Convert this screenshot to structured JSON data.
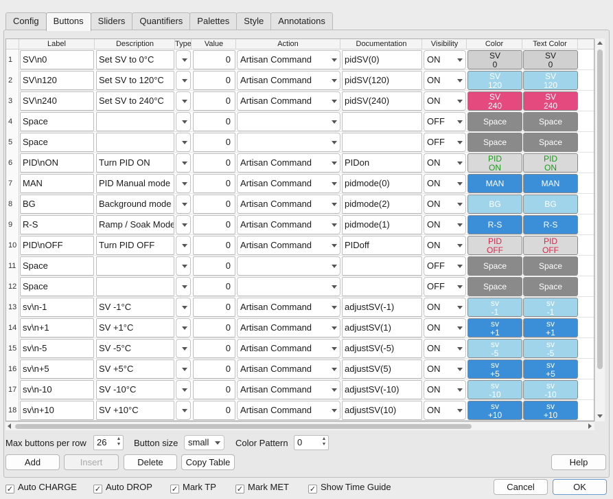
{
  "tabs": [
    "Config",
    "Buttons",
    "Sliders",
    "Quantifiers",
    "Palettes",
    "Style",
    "Annotations"
  ],
  "active_tab": "Buttons",
  "columns": [
    "Label",
    "Description",
    "Type",
    "Value",
    "Action",
    "Documentation",
    "Visibility",
    "Color",
    "Text Color"
  ],
  "rows": [
    {
      "n": "1",
      "label": "SV\\n0",
      "desc": "Set SV to 0°C",
      "value": "0",
      "action": "Artisan Command",
      "doc": "pidSV(0)",
      "vis": "ON",
      "swatch": "SV\n0",
      "bg": "#d0d0d0",
      "fg": "#1a1a1a"
    },
    {
      "n": "2",
      "label": "SV\\n120",
      "desc": "Set SV to 120°C",
      "value": "0",
      "action": "Artisan Command",
      "doc": "pidSV(120)",
      "vis": "ON",
      "swatch": "SV\n120",
      "bg": "#9fd4ea",
      "fg": "#ffffff"
    },
    {
      "n": "3",
      "label": "SV\\n240",
      "desc": "Set SV to 240°C",
      "value": "0",
      "action": "Artisan Command",
      "doc": "pidSV(240)",
      "vis": "ON",
      "swatch": "SV\n240",
      "bg": "#e44a7e",
      "fg": "#ffffff"
    },
    {
      "n": "4",
      "label": "Space",
      "desc": "",
      "value": "0",
      "action": "",
      "doc": "",
      "vis": "OFF",
      "swatch": "Space",
      "bg": "#8a8a8a",
      "fg": "#ffffff"
    },
    {
      "n": "5",
      "label": "Space",
      "desc": "",
      "value": "0",
      "action": "",
      "doc": "",
      "vis": "OFF",
      "swatch": "Space",
      "bg": "#8a8a8a",
      "fg": "#ffffff"
    },
    {
      "n": "6",
      "label": "PID\\nON",
      "desc": "Turn PID ON",
      "value": "0",
      "action": "Artisan Command",
      "doc": "PIDon",
      "vis": "ON",
      "swatch": "PID\nON",
      "bg": "#d9d9d9",
      "fg": "#1a9c1a"
    },
    {
      "n": "7",
      "label": "MAN",
      "desc": "PID Manual mode",
      "value": "0",
      "action": "Artisan Command",
      "doc": "pidmode(0)",
      "vis": "ON",
      "swatch": "MAN",
      "bg": "#3a8fd8",
      "fg": "#ffffff"
    },
    {
      "n": "8",
      "label": "BG",
      "desc": "Background mode",
      "value": "0",
      "action": "Artisan Command",
      "doc": "pidmode(2)",
      "vis": "ON",
      "swatch": "BG",
      "bg": "#9fd4ea",
      "fg": "#ffffff"
    },
    {
      "n": "9",
      "label": "R-S",
      "desc": "Ramp / Soak Mode",
      "value": "0",
      "action": "Artisan Command",
      "doc": "pidmode(1)",
      "vis": "ON",
      "swatch": "R-S",
      "bg": "#3a8fd8",
      "fg": "#ffffff"
    },
    {
      "n": "10",
      "label": "PID\\nOFF",
      "desc": "Turn PID OFF",
      "value": "0",
      "action": "Artisan Command",
      "doc": "PIDoff",
      "vis": "ON",
      "swatch": "PID\nOFF",
      "bg": "#d9d9d9",
      "fg": "#d9264d"
    },
    {
      "n": "11",
      "label": "Space",
      "desc": "",
      "value": "0",
      "action": "",
      "doc": "",
      "vis": "OFF",
      "swatch": "Space",
      "bg": "#8a8a8a",
      "fg": "#ffffff"
    },
    {
      "n": "12",
      "label": "Space",
      "desc": "",
      "value": "0",
      "action": "",
      "doc": "",
      "vis": "OFF",
      "swatch": "Space",
      "bg": "#8a8a8a",
      "fg": "#ffffff"
    },
    {
      "n": "13",
      "label": "sv\\n-1",
      "desc": "SV -1°C",
      "value": "0",
      "action": "Artisan Command",
      "doc": "adjustSV(-1)",
      "vis": "ON",
      "swatch": "sv\n-1",
      "bg": "#9fd4ea",
      "fg": "#ffffff"
    },
    {
      "n": "14",
      "label": "sv\\n+1",
      "desc": "SV +1°C",
      "value": "0",
      "action": "Artisan Command",
      "doc": "adjustSV(1)",
      "vis": "ON",
      "swatch": "sv\n+1",
      "bg": "#3a8fd8",
      "fg": "#ffffff"
    },
    {
      "n": "15",
      "label": "sv\\n-5",
      "desc": "SV -5°C",
      "value": "0",
      "action": "Artisan Command",
      "doc": "adjustSV(-5)",
      "vis": "ON",
      "swatch": "sv\n-5",
      "bg": "#9fd4ea",
      "fg": "#ffffff"
    },
    {
      "n": "16",
      "label": "sv\\n+5",
      "desc": "SV +5°C",
      "value": "0",
      "action": "Artisan Command",
      "doc": "adjustSV(5)",
      "vis": "ON",
      "swatch": "sv\n+5",
      "bg": "#3a8fd8",
      "fg": "#ffffff"
    },
    {
      "n": "17",
      "label": "sv\\n-10",
      "desc": "SV -10°C",
      "value": "0",
      "action": "Artisan Command",
      "doc": "adjustSV(-10)",
      "vis": "ON",
      "swatch": "sv\n-10",
      "bg": "#9fd4ea",
      "fg": "#ffffff"
    },
    {
      "n": "18",
      "label": "sv\\n+10",
      "desc": "SV +10°C",
      "value": "0",
      "action": "Artisan Command",
      "doc": "adjustSV(10)",
      "vis": "ON",
      "swatch": "sv\n+10",
      "bg": "#3a8fd8",
      "fg": "#ffffff"
    }
  ],
  "controls": {
    "max_buttons_label": "Max buttons per row",
    "max_buttons_value": "26",
    "button_size_label": "Button size",
    "button_size_value": "small",
    "color_pattern_label": "Color Pattern",
    "color_pattern_value": "0"
  },
  "buttons": {
    "add": "Add",
    "insert": "Insert",
    "delete": "Delete",
    "copy_table": "Copy Table",
    "help": "Help",
    "cancel": "Cancel",
    "ok": "OK"
  },
  "checkboxes": [
    {
      "label": "Auto CHARGE",
      "checked": true
    },
    {
      "label": "Auto DROP",
      "checked": true
    },
    {
      "label": "Mark TP",
      "checked": true
    },
    {
      "label": "Mark MET",
      "checked": true
    },
    {
      "label": "Show Time Guide",
      "checked": true
    }
  ]
}
